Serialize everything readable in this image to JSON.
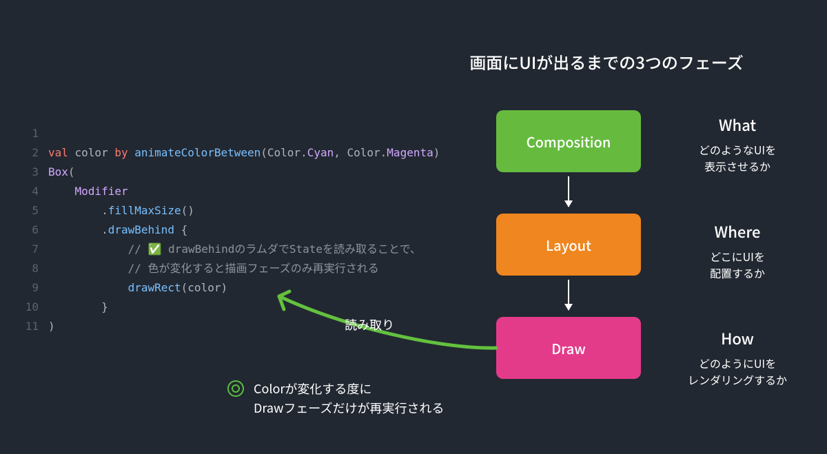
{
  "title": "画面にUIが出るまでの3つのフェーズ",
  "code": {
    "lines": [
      {
        "n": 1,
        "segs": []
      },
      {
        "n": 2,
        "segs": [
          {
            "t": "val ",
            "c": "kw"
          },
          {
            "t": "color ",
            "c": "ident"
          },
          {
            "t": "by ",
            "c": "kw"
          },
          {
            "t": "animateColorBetween",
            "c": "fn"
          },
          {
            "t": "(Color.",
            "c": "ident"
          },
          {
            "t": "Cyan",
            "c": "type"
          },
          {
            "t": ", Color.",
            "c": "ident"
          },
          {
            "t": "Magenta",
            "c": "type"
          },
          {
            "t": ")",
            "c": "ident"
          }
        ]
      },
      {
        "n": 3,
        "segs": [
          {
            "t": "Box",
            "c": "type"
          },
          {
            "t": "(",
            "c": "ident"
          }
        ]
      },
      {
        "n": 4,
        "segs": [
          {
            "t": "    ",
            "c": "ident"
          },
          {
            "t": "Modifier",
            "c": "type"
          }
        ]
      },
      {
        "n": 5,
        "segs": [
          {
            "t": "        .",
            "c": "ident"
          },
          {
            "t": "fillMaxSize",
            "c": "fn"
          },
          {
            "t": "()",
            "c": "ident"
          }
        ]
      },
      {
        "n": 6,
        "segs": [
          {
            "t": "        .",
            "c": "ident"
          },
          {
            "t": "drawBehind",
            "c": "fn"
          },
          {
            "t": " {",
            "c": "ident"
          }
        ]
      },
      {
        "n": 7,
        "segs": [
          {
            "t": "            ",
            "c": "ident"
          },
          {
            "t": "// ✅ drawBehindのラムダでStateを読み取ることで、",
            "c": "comment"
          }
        ]
      },
      {
        "n": 8,
        "segs": [
          {
            "t": "            ",
            "c": "ident"
          },
          {
            "t": "// 色が変化すると描画フェーズのみ再実行される",
            "c": "comment"
          }
        ]
      },
      {
        "n": 9,
        "segs": [
          {
            "t": "            ",
            "c": "ident"
          },
          {
            "t": "drawRect",
            "c": "fn"
          },
          {
            "t": "(color)",
            "c": "ident"
          }
        ]
      },
      {
        "n": 10,
        "segs": [
          {
            "t": "        }",
            "c": "ident"
          }
        ]
      },
      {
        "n": 11,
        "segs": [
          {
            "t": ")",
            "c": "ident"
          }
        ]
      }
    ]
  },
  "phases": {
    "composition": "Composition",
    "layout": "Layout",
    "draw": "Draw"
  },
  "descs": {
    "what": {
      "h": "What",
      "p1": "どのようなUIを",
      "p2": "表示させるか"
    },
    "where": {
      "h": "Where",
      "p1": "どこにUIを",
      "p2": "配置するか"
    },
    "how": {
      "h": "How",
      "p1": "どのようにUIを",
      "p2": "レンダリングするか"
    }
  },
  "note": {
    "l1": "Colorが変化する度に",
    "l2": "Drawフェーズだけが再実行される"
  },
  "read_label": "読み取り"
}
